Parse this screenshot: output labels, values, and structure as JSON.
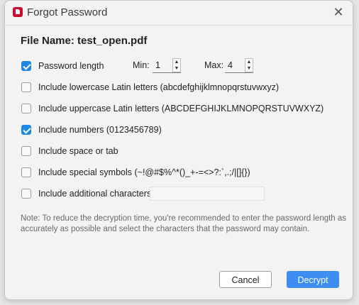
{
  "dialog": {
    "title": "Forgot Password",
    "file_name_label": "File Name:",
    "file_name": "test_open.pdf"
  },
  "options": [
    {
      "label": "Password length",
      "checked": true
    },
    {
      "label": "Include lowercase Latin letters (abcdefghijklmnopqrstuvwxyz)",
      "checked": false
    },
    {
      "label": "Include uppercase Latin letters (ABCDEFGHIJKLMNOPQRSTUVWXYZ)",
      "checked": false
    },
    {
      "label": "Include numbers (0123456789)",
      "checked": true
    },
    {
      "label": "Include space or tab",
      "checked": false
    },
    {
      "label": "Include special symbols (~!@#$%^*()_+-=<>?:`,.;/|[]{})",
      "checked": false
    },
    {
      "label": "Include additional characters",
      "checked": false
    }
  ],
  "length": {
    "min_label": "Min:",
    "min_value": "1",
    "max_label": "Max:",
    "max_value": "4"
  },
  "note": "Note: To reduce the decryption time, you're recommended to enter the password length as accurately as possible and select the characters that the password may contain.",
  "buttons": {
    "cancel": "Cancel",
    "decrypt": "Decrypt"
  },
  "colors": {
    "accent": "#3d8ef0",
    "checkbox_checked": "#1e88e5",
    "app_icon": "#c8102e"
  }
}
